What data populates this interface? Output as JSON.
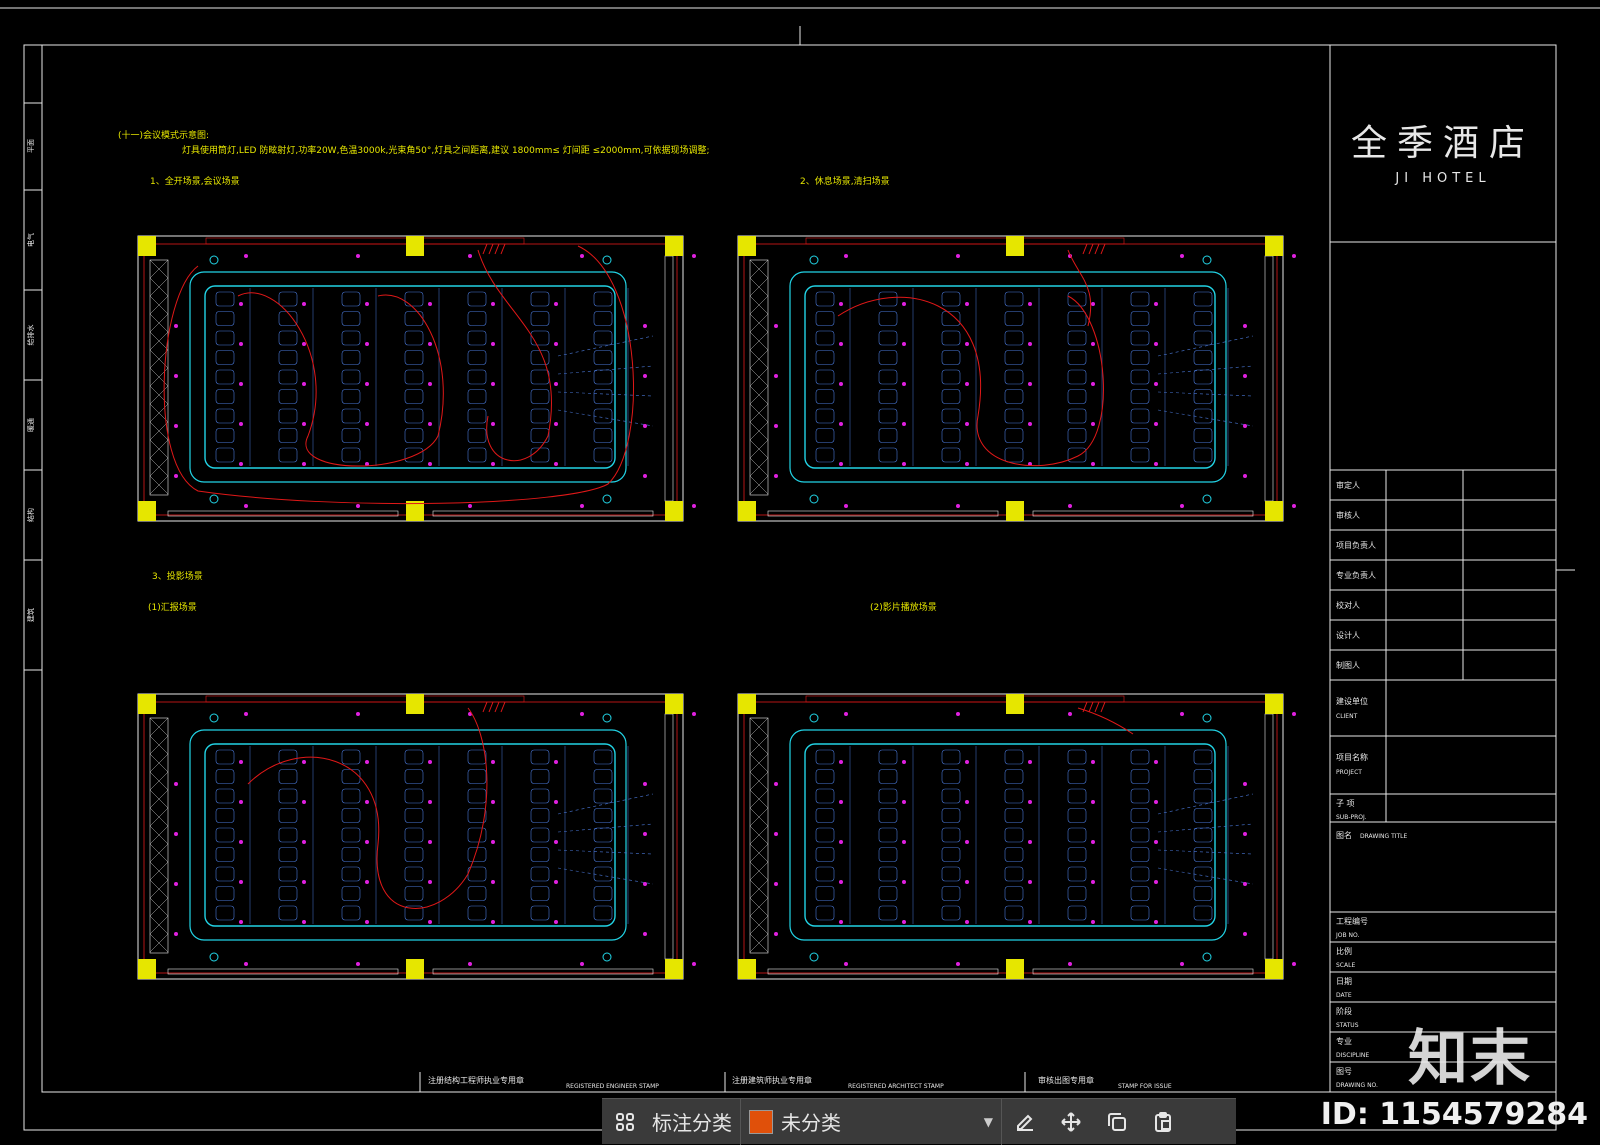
{
  "drawing": {
    "title_line1": "(十一)会议模式示意图:",
    "title_line2": "灯具使用筒灯,LED 防眩射灯,功率20W,色温3000k,光束角50°,灯具之间距离,建议 1800mm≤ 灯间距 ≤2000mm,可依据现场调整;",
    "scene1": "1、全开场景,会议场景",
    "scene2": "2、休息场景,清扫场景",
    "scene3": "3、投影场景",
    "scene3a": "(1)汇报场景",
    "scene3b": "(2)影片播放场景"
  },
  "title_block": {
    "brand_cn": "全季酒店",
    "brand_en": "JI HOTEL",
    "rows": [
      "审定人",
      "审核人",
      "项目负责人",
      "专业负责人",
      "校对人",
      "设计人",
      "制图人"
    ],
    "client_cn": "建设单位",
    "client_en": "CLIENT",
    "project_cn": "项目名称",
    "project_en": "PROJECT",
    "subproj_cn": "子 项",
    "subproj_en": "SUB-PROJ.",
    "drawing_title_cn": "图名",
    "drawing_title_en": "DRAWING TITLE",
    "job_cn": "工程编号",
    "job_en": "JOB NO.",
    "scale_cn": "比例",
    "scale_en": "SCALE",
    "date_cn": "日期",
    "date_en": "DATE",
    "status_cn": "阶段",
    "status_en": "STATUS",
    "disc_cn": "专业",
    "disc_en": "DISCIPLINE",
    "dwgno_cn": "图号",
    "dwgno_en": "DRAWING NO."
  },
  "stamps": {
    "s1_cn": "注册结构工程师执业专用章",
    "s1_en": "REGISTERED ENGINEER STAMP",
    "s2_cn": "注册建筑师执业专用章",
    "s2_en": "REGISTERED ARCHITECT STAMP",
    "s3_cn": "审核出图专用章",
    "s3_en": "STAMP FOR ISSUE"
  },
  "left_strip": [
    "平面",
    "电气",
    "给排水",
    "暖通",
    "结构",
    "建筑"
  ],
  "toolbar": {
    "category_label": "标注分类",
    "selected_value": "未分类",
    "swatch_color": "#e0500a"
  },
  "watermark": {
    "logo": "知末",
    "id": "ID: 1154579284"
  },
  "colors": {
    "yellow": "#e6e600",
    "cyan": "#22d4e6",
    "magenta": "#e020e0",
    "red": "#e01818",
    "blue": "#4a78d8",
    "white": "#e8e8e8"
  }
}
